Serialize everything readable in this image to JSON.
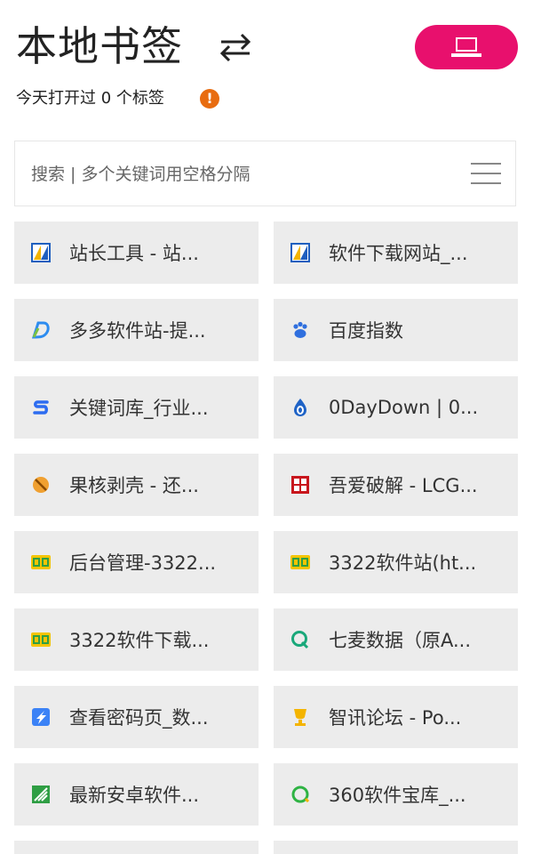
{
  "header": {
    "title": "本地书签",
    "subtitle": "今天打开过 0 个标签",
    "warning_glyph": "!",
    "toggle_color": "#e8106d"
  },
  "search": {
    "placeholder": "搜索 | 多个关键词用空格分隔",
    "value": ""
  },
  "bookmarks": [
    {
      "label": "站长工具 - 站...",
      "icon": "chinaz-icon"
    },
    {
      "label": "软件下载网站_...",
      "icon": "chinaz-icon"
    },
    {
      "label": "多多软件站-提...",
      "icon": "duote-icon"
    },
    {
      "label": "百度指数",
      "icon": "baidu-paw-icon"
    },
    {
      "label": "关键词库_行业...",
      "icon": "s-logo-icon"
    },
    {
      "label": "0DayDown | 0...",
      "icon": "drop-icon"
    },
    {
      "label": "果核剥壳 - 还...",
      "icon": "nocircle-icon"
    },
    {
      "label": "吾爱破解 - LCG...",
      "icon": "52pojie-icon"
    },
    {
      "label": "后台管理-3322...",
      "icon": "3322-icon"
    },
    {
      "label": "3322软件站(ht...",
      "icon": "3322-icon"
    },
    {
      "label": "3322软件下载...",
      "icon": "3322-icon"
    },
    {
      "label": "七麦数据（原A...",
      "icon": "q-icon"
    },
    {
      "label": "查看密码页_数...",
      "icon": "send-icon"
    },
    {
      "label": "智讯论坛 - Po...",
      "icon": "trophy-icon"
    },
    {
      "label": "最新安卓软件...",
      "icon": "android-icon"
    },
    {
      "label": "360软件宝库_...",
      "icon": "360-icon"
    }
  ]
}
